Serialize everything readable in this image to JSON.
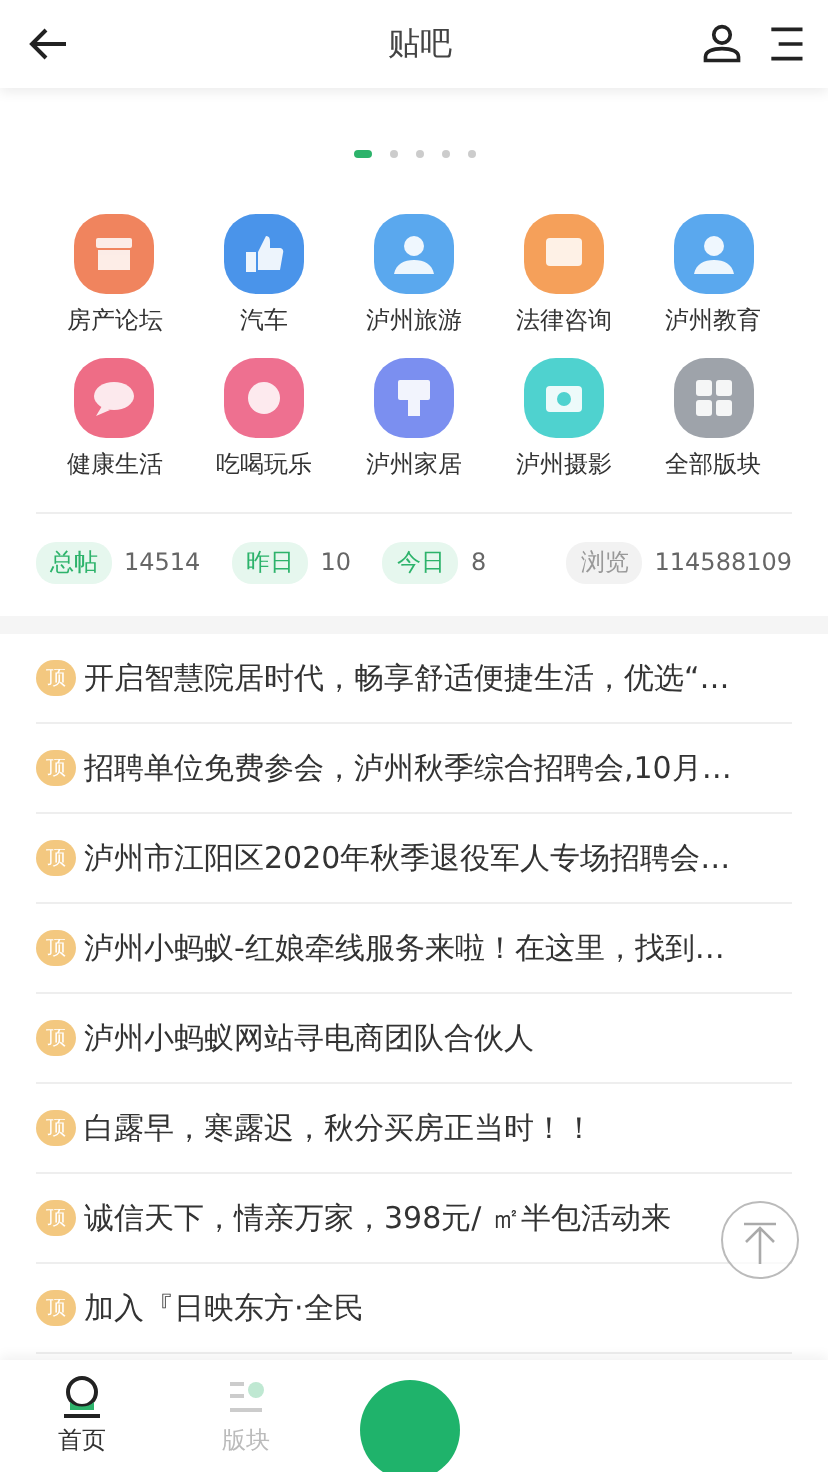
{
  "header": {
    "title": "贴吧"
  },
  "pager": [
    {
      "selected": true
    },
    {
      "selected": false
    },
    {
      "selected": false
    },
    {
      "selected": false
    },
    {
      "selected": false
    }
  ],
  "forums": [
    {
      "label": "房产论坛",
      "color": "#f0845e",
      "kind": "shop"
    },
    {
      "label": "汽车",
      "color": "#4a94ea",
      "kind": "thumb"
    },
    {
      "label": "泸州旅游",
      "color": "#5aa8ee",
      "kind": "person"
    },
    {
      "label": "法律咨询",
      "color": "#f5a05a",
      "kind": "chat"
    },
    {
      "label": "泸州教育",
      "color": "#5aa8ee",
      "kind": "person"
    },
    {
      "label": "健康生活",
      "color": "#ee6d86",
      "kind": "bubble"
    },
    {
      "label": "吃喝玩乐",
      "color": "#ee7090",
      "kind": "bird"
    },
    {
      "label": "泸州家居",
      "color": "#7b8ff0",
      "kind": "brush"
    },
    {
      "label": "泸州摄影",
      "color": "#4fd2cf",
      "kind": "camera"
    },
    {
      "label": "全部版块",
      "color": "#9ea3aa",
      "kind": "grid"
    }
  ],
  "stats": [
    {
      "tag": "总帖",
      "value": "14514"
    },
    {
      "tag": "昨日",
      "value": "10"
    },
    {
      "tag": "今日",
      "value": "8"
    }
  ],
  "views": {
    "tag": "浏览",
    "value": "114588109"
  },
  "posts": [
    {
      "badge": "顶",
      "title": "开启智慧院居时代，畅享舒适便捷生活，优选“…"
    },
    {
      "badge": "顶",
      "title": "招聘单位免费参会，泸州秋季综合招聘会,10月…"
    },
    {
      "badge": "顶",
      "title": "泸州市江阳区2020年秋季退役军人专场招聘会…"
    },
    {
      "badge": "顶",
      "title": "泸州小蚂蚁-红娘牵线服务来啦！在这里，找到…"
    },
    {
      "badge": "顶",
      "title": "泸州小蚂蚁网站寻电商团队合伙人"
    },
    {
      "badge": "顶",
      "title": "白露早，寒露迟，秋分买房正当时！！"
    },
    {
      "badge": "顶",
      "title": "诚信天下，情亲万家，398元/ ㎡半包活动来"
    },
    {
      "badge": "顶",
      "title": "加入『日映东方·全民"
    }
  ],
  "tabbar": [
    {
      "label": "首页",
      "selected": true,
      "kind": "home"
    },
    {
      "label": "版块",
      "selected": false,
      "kind": "list"
    }
  ]
}
